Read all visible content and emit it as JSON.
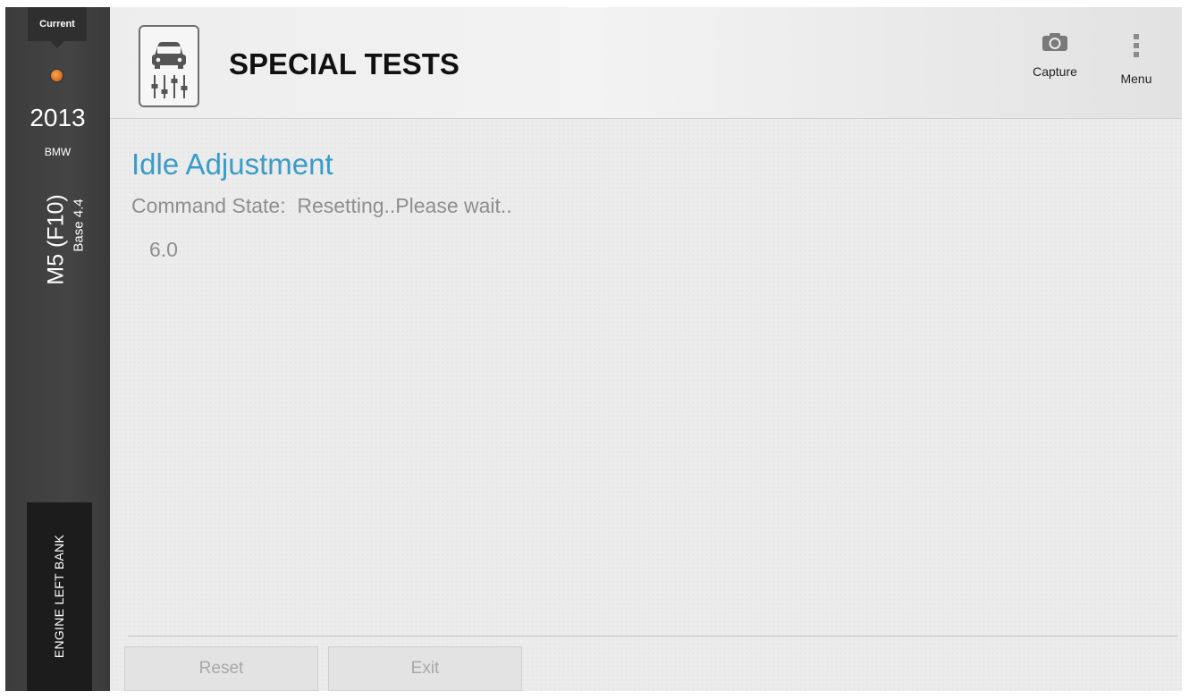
{
  "sidebar": {
    "status_label": "Current",
    "status_color": "#e0782a",
    "year": "2013",
    "make": "BMW",
    "model": "M5 (F10)",
    "engine": "Base 4.4",
    "module": "ENGINE LEFT BANK"
  },
  "header": {
    "title": "SPECIAL TESTS",
    "icon": "car-sliders-icon",
    "capture_label": "Capture",
    "capture_icon": "camera-icon",
    "menu_label": "Menu",
    "menu_icon": "vertical-dots-icon"
  },
  "main": {
    "test_title": "Idle Adjustment",
    "command_state": "Command State:  Resetting..Please wait..",
    "value": "6.0",
    "accent_color": "#3a9cc7"
  },
  "footer": {
    "reset_label": "Reset",
    "exit_label": "Exit"
  }
}
